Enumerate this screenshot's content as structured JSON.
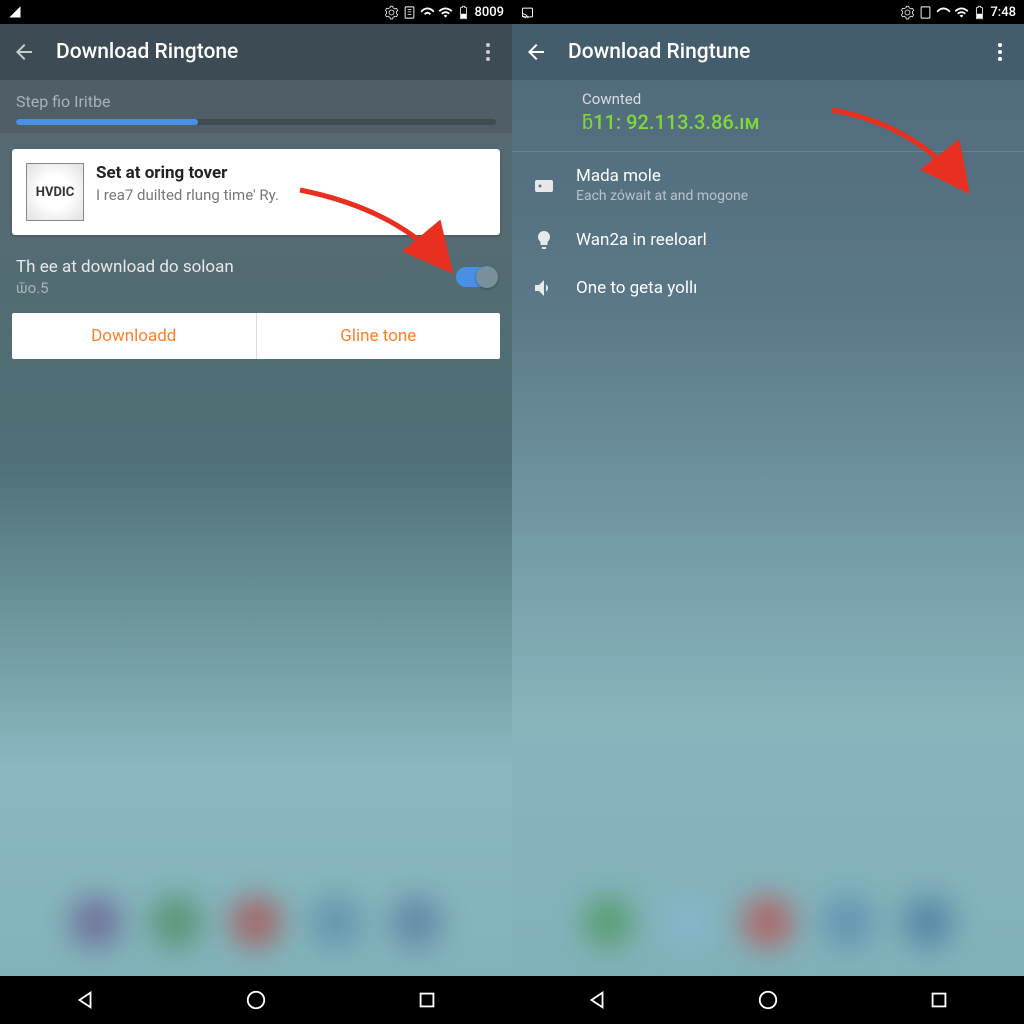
{
  "left": {
    "statusTime": "8009",
    "appTitle": "Download Ringtone",
    "stepLabel": "Step fio Iritbe",
    "card": {
      "iconText": "HVDIC",
      "title": "Set at oring tover",
      "subtitle": "I rea7 duilted rlung time'\nRy."
    },
    "setting": {
      "title": "Th ee at download do soloan",
      "sub": "ѿo.5"
    },
    "buttons": {
      "download": "Downloadd",
      "glinetone": "Gline tone"
    }
  },
  "right": {
    "statusTime": "7:48",
    "appTitle": "Download Ringtune",
    "info": {
      "label": "Cownted",
      "value": "ƃ11: 92.113.3.86.ıм"
    },
    "items": [
      {
        "title": "Mada mole",
        "sub": "Each zówait at and mogone"
      },
      {
        "title": "Wan2a in reeloarl",
        "sub": ""
      },
      {
        "title": "One to geta yollı",
        "sub": ""
      }
    ]
  }
}
